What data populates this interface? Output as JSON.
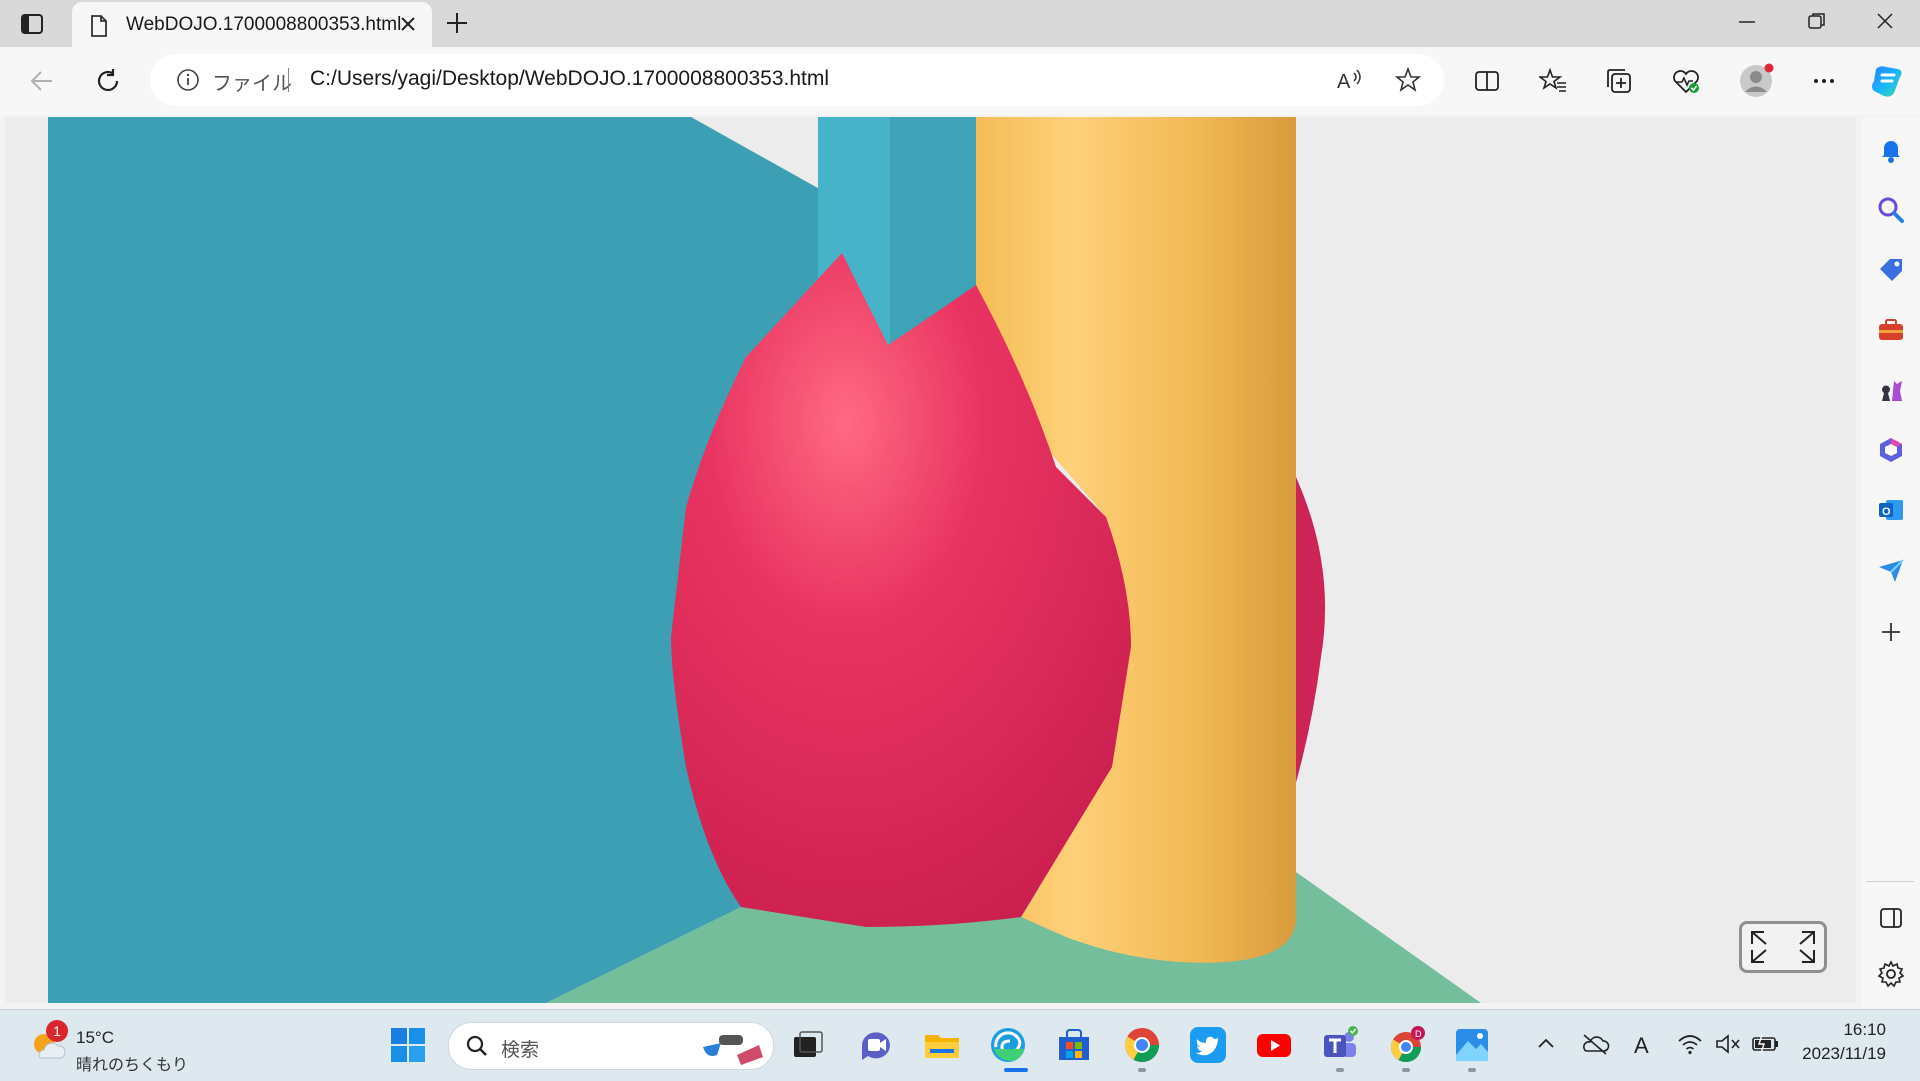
{
  "browser": {
    "tab_title": "WebDOJO.1700008800353.html",
    "address_label": "ファイル",
    "address_url": "C:/Users/yagi/Desktop/WebDOJO.1700008800353.html"
  },
  "taskbar": {
    "weather_temp": "15°C",
    "weather_condition": "晴れのちくもり",
    "weather_badge": "1",
    "search_placeholder": "検索",
    "clock_time": "16:10",
    "clock_date": "2023/11/19"
  },
  "scene_colors": {
    "wall_blue": "#3d9fb3",
    "pillar_blue": "#47b3c8",
    "floor_green": "#74be9b",
    "cylinder_yellow": "#f0bb55",
    "egg_red": "#e2305e"
  }
}
